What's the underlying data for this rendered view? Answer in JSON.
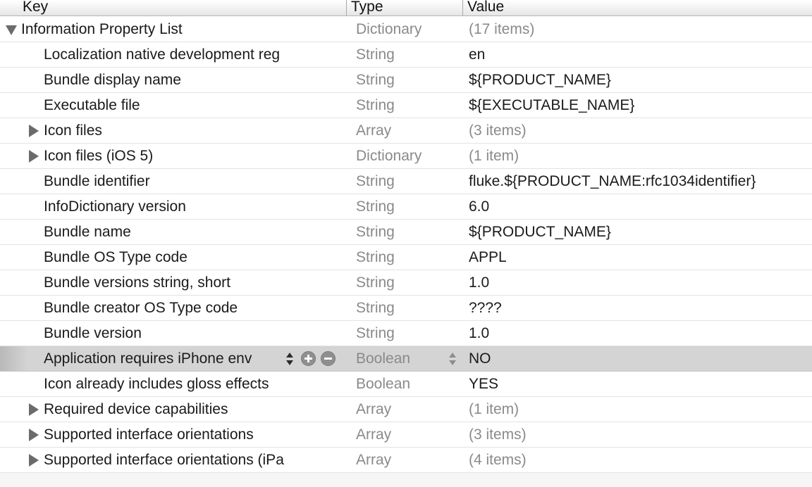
{
  "header": {
    "key": "Key",
    "type": "Type",
    "value": "Value"
  },
  "rows": [
    {
      "key": "Information Property List",
      "type": "Dictionary",
      "value": "(17 items)"
    },
    {
      "key": "Localization native development reg",
      "type": "String",
      "value": "en"
    },
    {
      "key": "Bundle display name",
      "type": "String",
      "value": "${PRODUCT_NAME}"
    },
    {
      "key": "Executable file",
      "type": "String",
      "value": "${EXECUTABLE_NAME}"
    },
    {
      "key": "Icon files",
      "type": "Array",
      "value": "(3 items)"
    },
    {
      "key": "Icon files (iOS 5)",
      "type": "Dictionary",
      "value": "(1 item)"
    },
    {
      "key": "Bundle identifier",
      "type": "String",
      "value": "fluke.${PRODUCT_NAME:rfc1034identifier}"
    },
    {
      "key": "InfoDictionary version",
      "type": "String",
      "value": "6.0"
    },
    {
      "key": "Bundle name",
      "type": "String",
      "value": "${PRODUCT_NAME}"
    },
    {
      "key": "Bundle OS Type code",
      "type": "String",
      "value": "APPL"
    },
    {
      "key": "Bundle versions string, short",
      "type": "String",
      "value": "1.0"
    },
    {
      "key": "Bundle creator OS Type code",
      "type": "String",
      "value": "????"
    },
    {
      "key": "Bundle version",
      "type": "String",
      "value": "1.0"
    },
    {
      "key": "Application requires iPhone env",
      "type": "Boolean",
      "value": "NO"
    },
    {
      "key": "Icon already includes gloss effects",
      "type": "Boolean",
      "value": "YES"
    },
    {
      "key": "Required device capabilities",
      "type": "Array",
      "value": "(1 item)"
    },
    {
      "key": "Supported interface orientations",
      "type": "Array",
      "value": "(3 items)"
    },
    {
      "key": "Supported interface orientations (iPa",
      "type": "Array",
      "value": "(4 items)"
    }
  ],
  "icons": {
    "disclosure_open": "disclosure-triangle-down-icon",
    "disclosure_closed": "disclosure-triangle-right-icon",
    "stepper": "up-down-stepper-icon",
    "add": "plus-circle-icon",
    "remove": "minus-circle-icon"
  },
  "colors": {
    "selected_row": "#d4d4d4",
    "muted_text": "#8a8a8a"
  }
}
